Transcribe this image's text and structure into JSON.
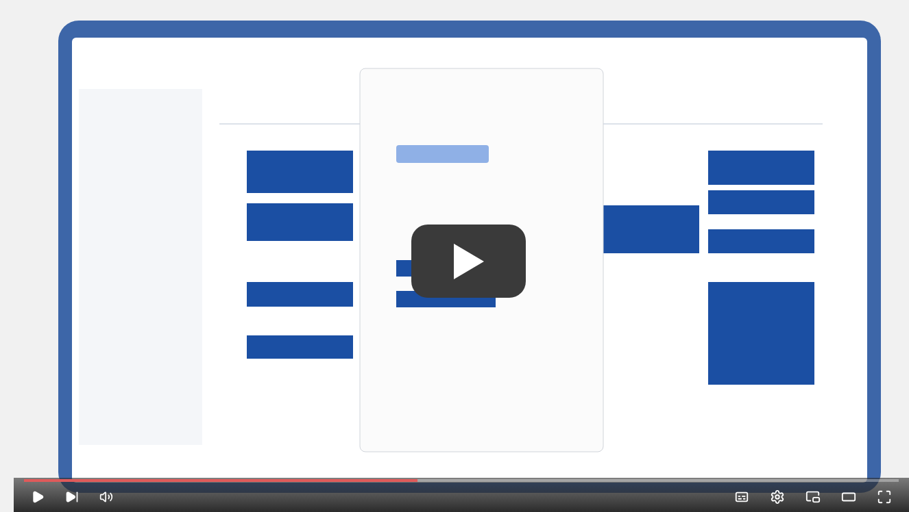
{
  "player": {
    "progress": {
      "level": 0.45
    }
  }
}
